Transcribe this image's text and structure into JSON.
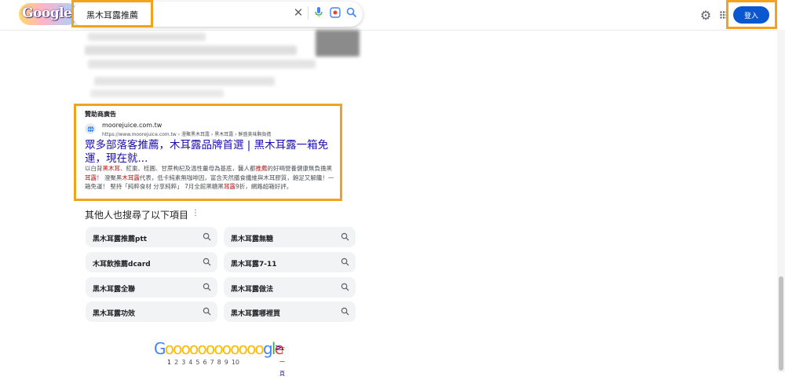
{
  "header": {
    "logo_text": "Google",
    "query": "黑木耳露推薦",
    "login_label": "登入"
  },
  "ad": {
    "label": "贊助商廣告",
    "site_name": "moorejuice.com.tw",
    "site_url": "https://www.moorejuice.com.tw › 澄聚黑木耳露 › 黑木耳露 › 鮮盛美味無負擔",
    "title": "眾多部落客推薦，木耳露品牌首選 | 黑木耳露一箱免運，現在就...",
    "desc_1": "以白背",
    "desc_em_1": "黑木耳",
    "desc_2": "、紅棗、桂圓、甘蔗枸杞及溫性薑母為基底，醫人都",
    "desc_em_2": "推薦",
    "desc_3": "的好喝營養健康無負擔黑",
    "desc_em_3": "耳露",
    "desc_4": "！ 澄聚黑",
    "desc_em_4": "木耳露",
    "desc_5": "代表，低卡純素無咖啡因，富含天然膳食纖維與木耳膠質，飽足又解饞！一箱免運！ 堅持「純粹食材 分享純粹」 7月全館黑糖黑",
    "desc_em_5": "耳露",
    "desc_6": "9折，網路超箱好評。"
  },
  "related": {
    "heading": "其他人也搜尋了以下項目",
    "items": [
      "黑木耳露推薦ptt",
      "黑木耳露無糖",
      "木耳飲推薦dcard",
      "黑木耳露7-11",
      "黑木耳露全聯",
      "黑木耳露做法",
      "黑木耳露功效",
      "黑木耳露哪裡買"
    ]
  },
  "pagination": {
    "logo_g1": "G",
    "logo_os": "oooooooooooo",
    "logo_g2": "g",
    "logo_l": "l",
    "logo_e": "e",
    "pages": [
      "1",
      "2",
      "3",
      "4",
      "5",
      "6",
      "7",
      "8",
      "9",
      "10"
    ],
    "next_label": "下一頁"
  },
  "colors": {
    "highlight": "#f2a31b",
    "link": "#1a0dab",
    "button": "#0b57d0"
  }
}
